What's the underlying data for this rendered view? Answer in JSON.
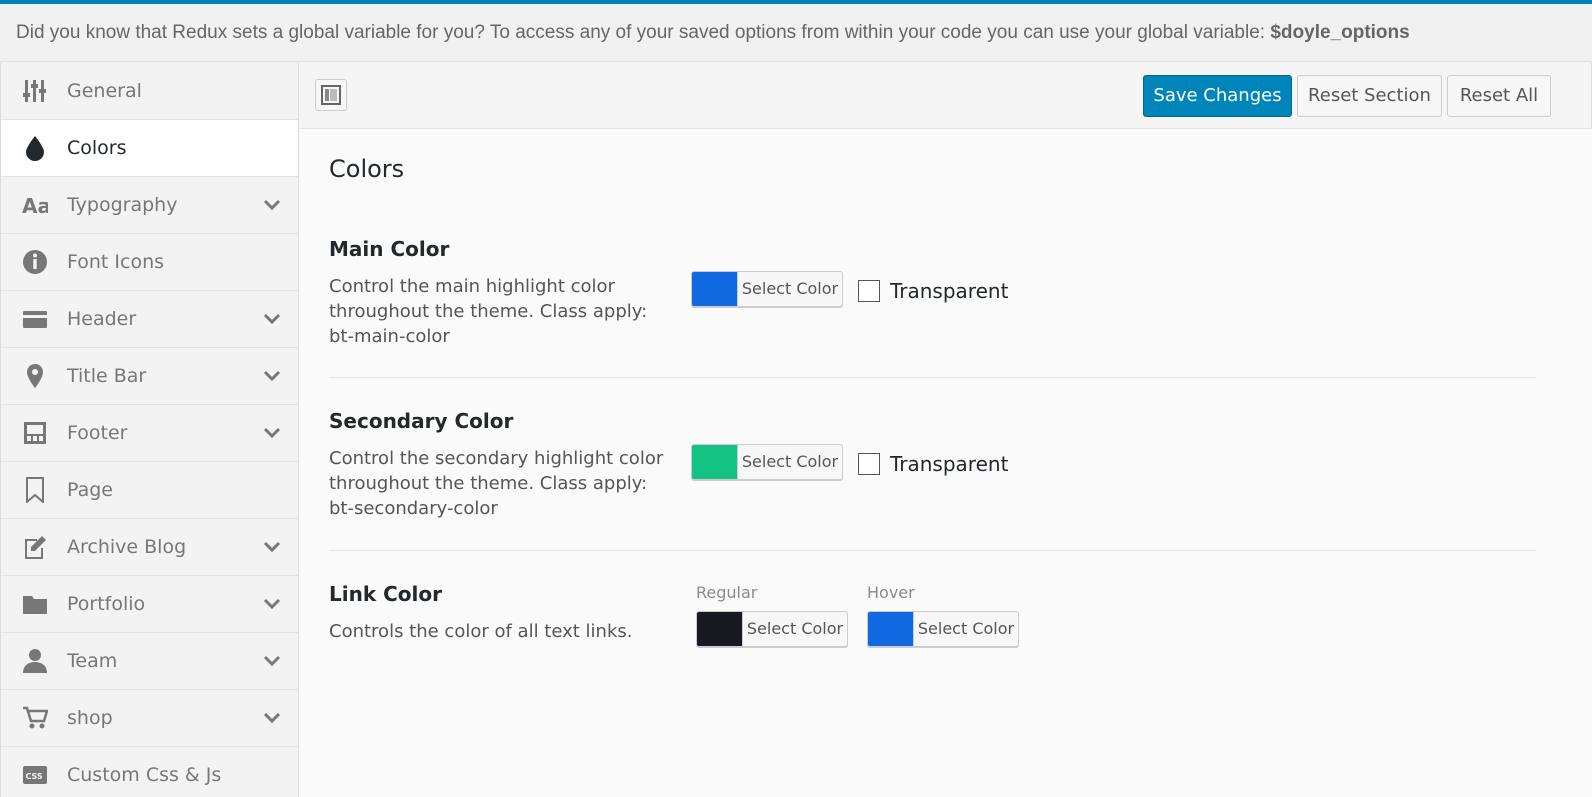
{
  "notice": {
    "text": "Did you know that Redux sets a global variable for you? To access any of your saved options from within your code you can use your global variable: ",
    "variable": "$doyle_options"
  },
  "sidebar": {
    "items": [
      {
        "label": "General",
        "icon": "sliders-icon",
        "has_children": false,
        "active": false
      },
      {
        "label": "Colors",
        "icon": "droplet-icon",
        "has_children": false,
        "active": true
      },
      {
        "label": "Typography",
        "icon": "font-icon",
        "has_children": true,
        "active": false
      },
      {
        "label": "Font Icons",
        "icon": "info-icon",
        "has_children": false,
        "active": false
      },
      {
        "label": "Header",
        "icon": "credit-card-icon",
        "has_children": true,
        "active": false
      },
      {
        "label": "Title Bar",
        "icon": "map-pin-icon",
        "has_children": true,
        "active": false
      },
      {
        "label": "Footer",
        "icon": "layout-icon",
        "has_children": true,
        "active": false
      },
      {
        "label": "Page",
        "icon": "bookmark-icon",
        "has_children": false,
        "active": false
      },
      {
        "label": "Archive Blog",
        "icon": "edit-icon",
        "has_children": true,
        "active": false
      },
      {
        "label": "Portfolio",
        "icon": "folder-icon",
        "has_children": true,
        "active": false
      },
      {
        "label": "Team",
        "icon": "user-icon",
        "has_children": true,
        "active": false
      },
      {
        "label": "shop",
        "icon": "cart-icon",
        "has_children": true,
        "active": false
      },
      {
        "label": "Custom Css & Js",
        "icon": "css-icon",
        "has_children": false,
        "active": false
      }
    ]
  },
  "toolbar": {
    "save_label": "Save Changes",
    "reset_section_label": "Reset Section",
    "reset_all_label": "Reset All"
  },
  "section": {
    "title": "Colors",
    "fields": {
      "main": {
        "title": "Main Color",
        "desc": "Control the main highlight color throughout the theme. Class apply: bt-main-color",
        "color": "#1069e0",
        "button_label": "Select Color",
        "transparent_label": "Transparent"
      },
      "secondary": {
        "title": "Secondary Color",
        "desc": "Control the secondary highlight color throughout the theme. Class apply: bt-secondary-color",
        "color": "#12c384",
        "button_label": "Select Color",
        "transparent_label": "Transparent"
      },
      "link": {
        "title": "Link Color",
        "desc": "Controls the color of all text links.",
        "regular_label": "Regular",
        "regular_color": "#181820",
        "hover_label": "Hover",
        "hover_color": "#1069e0",
        "button_label": "Select Color"
      }
    }
  },
  "colors": {
    "accent": "#0085ba"
  }
}
